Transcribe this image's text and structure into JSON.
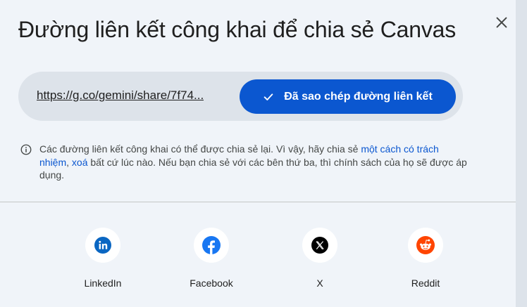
{
  "dialog": {
    "title": "Đường liên kết công khai để chia sẻ Canvas",
    "close_icon": "close-icon"
  },
  "link": {
    "url": "https://g.co/gemini/share/7f74...",
    "copy_button_label": "Đã sao chép đường liên kết",
    "copy_icon": "check-icon"
  },
  "notice": {
    "text_before": "Các đường liên kết công khai có thể được chia sẻ lại. Vì vậy, hãy chia sẻ ",
    "link_responsible": "một cách có trách nhiệm",
    "separator": ", ",
    "link_delete": "xoá",
    "text_after": " bất cứ lúc nào. Nếu bạn chia sẻ với các bên thứ ba, thì chính sách của họ sẽ được áp dụng.",
    "icon": "info-icon"
  },
  "share_targets": [
    {
      "label": "LinkedIn",
      "icon": "linkedin-icon",
      "color": "#0a66c2"
    },
    {
      "label": "Facebook",
      "icon": "facebook-icon",
      "color": "#1877f2"
    },
    {
      "label": "X",
      "icon": "x-icon",
      "color": "#000000"
    },
    {
      "label": "Reddit",
      "icon": "reddit-icon",
      "color": "#ff4500"
    }
  ],
  "colors": {
    "background": "#f0f4f9",
    "link_field": "#dde3ea",
    "primary": "#0b57d0",
    "text": "#1f1f1f",
    "muted_text": "#444746"
  }
}
